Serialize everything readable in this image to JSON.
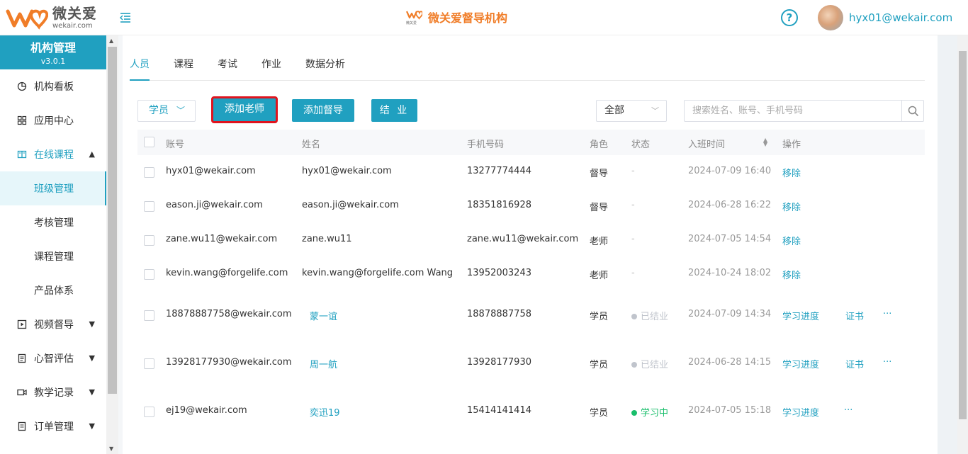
{
  "header": {
    "logo_cn": "微关爱",
    "logo_en": "wekair.com",
    "center_title": "微关爱督导机构",
    "center_mini_logo_text": "微关爱",
    "help_symbol": "?",
    "user_email": "hyx01@wekair.com"
  },
  "sidebar": {
    "title": "机构管理",
    "version": "v3.0.1",
    "items": [
      {
        "label": "机构看板",
        "icon": "dashboard-icon"
      },
      {
        "label": "应用中心",
        "icon": "grid-icon"
      },
      {
        "label": "在线课程",
        "icon": "book-icon",
        "expanded": true
      },
      {
        "label": "班级管理",
        "sub": true,
        "active": true
      },
      {
        "label": "考核管理",
        "sub": true
      },
      {
        "label": "课程管理",
        "sub": true
      },
      {
        "label": "产品体系",
        "sub": true
      },
      {
        "label": "视频督导",
        "icon": "video-icon"
      },
      {
        "label": "心智评估",
        "icon": "clipboard-icon"
      },
      {
        "label": "教学记录",
        "icon": "camera-icon"
      },
      {
        "label": "订单管理",
        "icon": "order-icon"
      }
    ]
  },
  "tabs": [
    "人员",
    "课程",
    "考试",
    "作业",
    "数据分析"
  ],
  "toolbar": {
    "role_select": "学员",
    "add_teacher": "添加老师",
    "add_supervisor": "添加督导",
    "graduate": "结 业",
    "filter_select": "全部",
    "search_placeholder": "搜索姓名、账号、手机号码"
  },
  "table": {
    "columns": [
      "账号",
      "姓名",
      "手机号码",
      "角色",
      "状态",
      "入班时间",
      "操作"
    ],
    "rows": [
      {
        "account": "hyx01@wekair.com",
        "name": "hyx01@wekair.com",
        "phone": "13277774444",
        "role": "督导",
        "status": "-",
        "time": "2024-07-09 16:40",
        "ops": [
          "移除"
        ]
      },
      {
        "account": "eason.ji@wekair.com",
        "name": "eason.ji@wekair.com",
        "phone": "18351816928",
        "role": "督导",
        "status": "-",
        "time": "2024-06-28 16:22",
        "ops": [
          "移除"
        ]
      },
      {
        "account": "zane.wu11@wekair.com",
        "name": "zane.wu11",
        "phone": "zane.wu11@wekair.com",
        "role": "老师",
        "status": "-",
        "time": "2024-07-05 14:54",
        "ops": [
          "移除"
        ]
      },
      {
        "account": "kevin.wang@forgelife.com",
        "name": "kevin.wang@forgelife.com Wang",
        "phone": "13952003243",
        "role": "老师",
        "status": "-",
        "time": "2024-10-24 18:02",
        "ops": [
          "移除"
        ]
      },
      {
        "account": "18878887758@wekair.com",
        "name": "蒙一谊",
        "phone": "18878887758",
        "role": "学员",
        "status": "已结业",
        "time": "2024-07-09 14:34",
        "ops": [
          "学习进度",
          "证书",
          "···"
        ]
      },
      {
        "account": "13928177930@wekair.com",
        "name": "周一航",
        "phone": "13928177930",
        "role": "学员",
        "status": "已结业",
        "time": "2024-06-28 14:15",
        "ops": [
          "学习进度",
          "证书",
          "···"
        ]
      },
      {
        "account": "ej19@wekair.com",
        "name": "奕迅19",
        "phone": "15414141414",
        "role": "学员",
        "status": "学习中",
        "time": "2024-07-05 15:18",
        "ops": [
          "学习进度",
          "···"
        ]
      }
    ]
  },
  "colors": {
    "accent": "#20a0c0",
    "brand_orange": "#f07d28",
    "highlight_red": "#e0141e",
    "status_green": "#19be6b"
  }
}
